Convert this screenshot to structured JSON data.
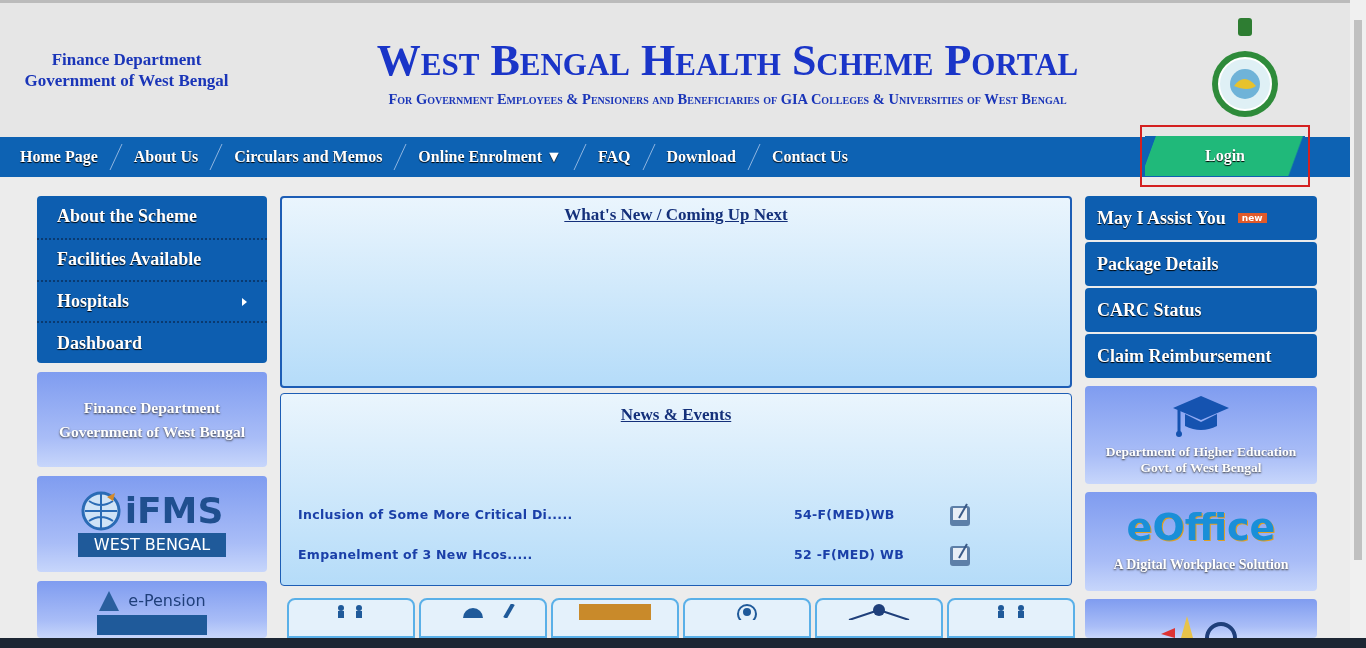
{
  "header": {
    "dept_lines": [
      "Finance Department",
      "Government of West Bengal"
    ],
    "title": "West Bengal Health Scheme Portal",
    "subtitle": "For Government Employees & Pensioners and Beneficiaries of GIA Colleges & Universities of West Bengal"
  },
  "nav": {
    "items": [
      {
        "label": "Home Page"
      },
      {
        "label": "About Us"
      },
      {
        "label": "Circulars and Memos"
      },
      {
        "label": "Online Enrolment",
        "caret": "▼"
      },
      {
        "label": "FAQ"
      },
      {
        "label": "Download"
      },
      {
        "label": "Contact Us"
      }
    ],
    "login": {
      "label": "Login",
      "highlighted": true
    }
  },
  "left_menu": [
    {
      "label": "About the Scheme",
      "submenu": false
    },
    {
      "label": "Facilities Available",
      "submenu": false
    },
    {
      "label": "Hospitals",
      "submenu": true
    },
    {
      "label": "Dashboard",
      "submenu": false
    }
  ],
  "left_cards": [
    {
      "kind": "text",
      "lines": [
        "Finance Department",
        "Government of West Bengal"
      ]
    },
    {
      "kind": "ifms",
      "logo": "iFMS",
      "band": "WEST BENGAL"
    },
    {
      "kind": "epension",
      "logo": "e-Pension"
    }
  ],
  "whats_new": {
    "title": "What's New / Coming Up Next"
  },
  "news": {
    "title": "News & Events",
    "rows": [
      {
        "title": "Inclusion of Some More Critical Di.....",
        "ref": "54-F(MED)WB"
      },
      {
        "title": "Empanelment of 3 New Hcos.....",
        "ref": "52 -F(MED) WB"
      }
    ]
  },
  "right_menu": [
    {
      "label": "May I Assist You",
      "badge": "new"
    },
    {
      "label": "Package Details"
    },
    {
      "label": "CARC Status"
    },
    {
      "label": "Claim Reimbursement"
    }
  ],
  "right_cards": [
    {
      "kind": "higher-ed",
      "lines": [
        "Department of Higher Education",
        "Govt. of West Bengal"
      ]
    },
    {
      "kind": "eoffice",
      "logo": "eOffice",
      "caption": "A Digital Workplace Solution"
    },
    {
      "kind": "gem"
    }
  ]
}
